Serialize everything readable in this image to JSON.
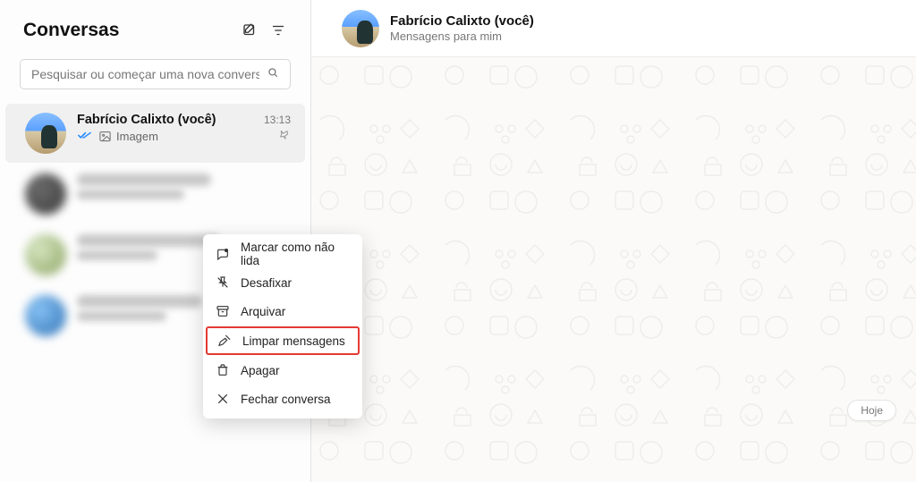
{
  "sidebar": {
    "title": "Conversas",
    "search_placeholder": "Pesquisar ou começar uma nova conversa"
  },
  "active_chat": {
    "name": "Fabrício Calixto (você)",
    "time": "13:13",
    "preview_label": "Imagem"
  },
  "context_menu": {
    "mark_unread": "Marcar como não lida",
    "unpin": "Desafixar",
    "archive": "Arquivar",
    "clear": "Limpar mensagens",
    "delete": "Apagar",
    "close": "Fechar conversa"
  },
  "header": {
    "name": "Fabrício Calixto (você)",
    "subtitle": "Mensagens para mim"
  },
  "chat_area": {
    "today_label": "Hoje"
  }
}
